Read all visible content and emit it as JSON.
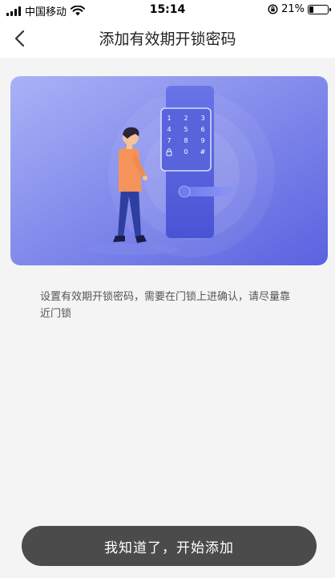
{
  "status_bar": {
    "carrier": "中国移动",
    "time": "15:14",
    "battery_percent": "21%",
    "battery_level": 0.21,
    "icons": [
      "signal-icon",
      "wifi-icon",
      "orientation-lock-icon",
      "battery-icon"
    ]
  },
  "nav": {
    "back_icon": "chevron-left-icon",
    "title": "添加有效期开锁密码"
  },
  "illustration": {
    "keypad_keys": [
      "1",
      "2",
      "3",
      "4",
      "5",
      "6",
      "7",
      "8",
      "9",
      "lock",
      "0",
      "#"
    ],
    "colors": {
      "card_start": "#9aa6f4",
      "card_end": "#5b64e2",
      "lock_body": "#5560dc",
      "shirt": "#f5965a",
      "pants": "#2e3e9c"
    }
  },
  "description": "设置有效期开锁密码，需要在门锁上进确认，请尽量靠近门锁",
  "primary_button": {
    "label": "我知道了，开始添加"
  }
}
